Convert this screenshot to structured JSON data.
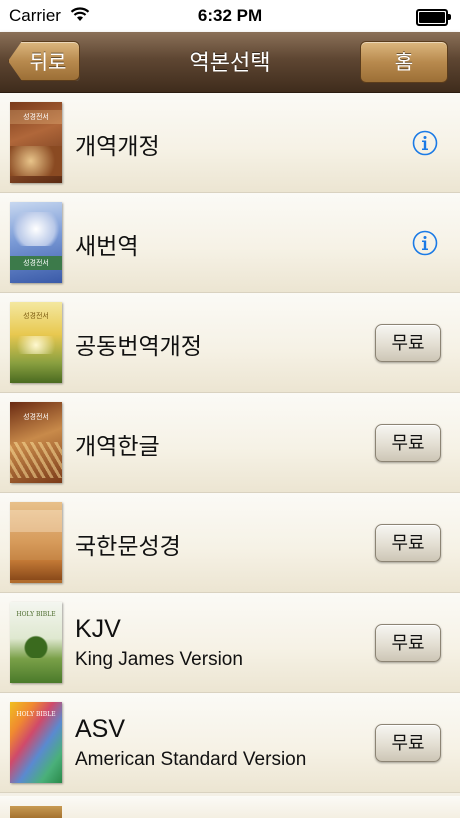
{
  "status_bar": {
    "carrier": "Carrier",
    "time": "6:32 PM"
  },
  "nav": {
    "back_label": "뒤로",
    "title": "역본선택",
    "home_label": "홈"
  },
  "free_label": "무료",
  "versions": [
    {
      "name": "개역개정",
      "subtitle": "",
      "action": "info",
      "cover_text": "성경전서"
    },
    {
      "name": "새번역",
      "subtitle": "",
      "action": "info",
      "cover_text": "성경전서"
    },
    {
      "name": "공동번역개정",
      "subtitle": "",
      "action": "free",
      "cover_text": "성경전서"
    },
    {
      "name": "개역한글",
      "subtitle": "",
      "action": "free",
      "cover_text": "성경전서"
    },
    {
      "name": "국한문성경",
      "subtitle": "",
      "action": "free",
      "cover_text": ""
    },
    {
      "name": "KJV",
      "subtitle": "King James Version",
      "action": "free",
      "cover_text": "HOLY BIBLE"
    },
    {
      "name": "ASV",
      "subtitle": "American Standard Version",
      "action": "free",
      "cover_text": "HOLY BIBLE"
    }
  ],
  "colors": {
    "info_blue": "#1a7ae6",
    "nav_brown": "#5e4632",
    "button_gold": "#b88a4e"
  }
}
